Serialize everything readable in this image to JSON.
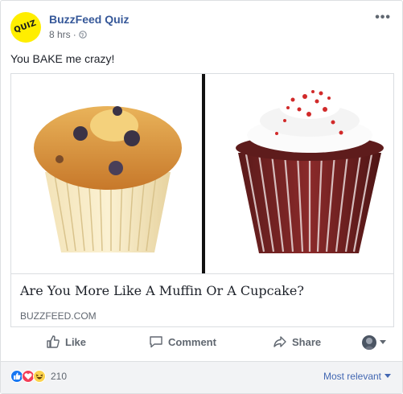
{
  "post": {
    "page_name": "BuzzFeed Quiz",
    "avatar_text": "QUIZ",
    "time": "8 hrs",
    "separator": "·",
    "caption": "You BAKE me crazy!",
    "more_label": "•••"
  },
  "card": {
    "headline": "Are You More Like A Muffin Or A Cupcake?",
    "domain": "BUZZFEED.COM",
    "left_image": "muffin",
    "right_image": "cupcake"
  },
  "actions": {
    "like": "Like",
    "comment": "Comment",
    "share": "Share"
  },
  "footer": {
    "reaction_count": "210",
    "sort_label": "Most relevant"
  },
  "colors": {
    "link_blue": "#365899",
    "sort_blue": "#4267b2",
    "like_blue": "#1877f2",
    "love_red": "#f33e58",
    "avatar_yellow": "#ffee00"
  }
}
